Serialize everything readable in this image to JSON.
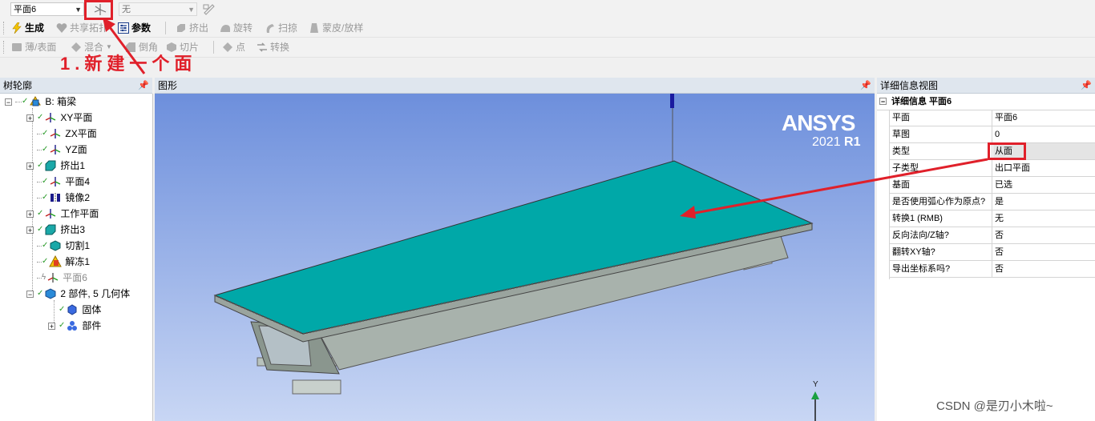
{
  "toolbar1": {
    "plane_select": "平面6",
    "sketch_select": "无"
  },
  "toolbar2": {
    "generate": "生成",
    "share_topology": "共享拓扑",
    "parameters": "参数",
    "extrude": "挤出",
    "revolve": "旋转",
    "sweep": "扫掠",
    "skin_loft": "蒙皮/放样"
  },
  "toolbar3": {
    "thin_surface": "薄/表面",
    "blend": "混合",
    "chamfer": "倒角",
    "slice": "切片",
    "point": "点",
    "conversion": "转换"
  },
  "annotation": {
    "text": "1.新建一个面",
    "color": "#e0202a"
  },
  "tree": {
    "title": "树轮廓",
    "items": [
      {
        "label": "B: 箱梁"
      },
      {
        "label": "XY平面"
      },
      {
        "label": "ZX平面"
      },
      {
        "label": "YZ面"
      },
      {
        "label": "挤出1"
      },
      {
        "label": "平面4"
      },
      {
        "label": "镜像2"
      },
      {
        "label": "工作平面"
      },
      {
        "label": "挤出3"
      },
      {
        "label": "切割1"
      },
      {
        "label": "解冻1"
      },
      {
        "label": "平面6"
      },
      {
        "label": "2 部件, 5 几何体"
      },
      {
        "label": "固体"
      },
      {
        "label": "部件"
      }
    ]
  },
  "graphics": {
    "title": "图形",
    "brand": "ANSYS",
    "version_year": "2021",
    "version_release": "R1",
    "axis_y": "Y",
    "colors": {
      "deck": "#00a8a8",
      "bg_top": "#6d8fdc",
      "bg_bottom": "#c8d6f4",
      "beam": "#b5c0b8"
    }
  },
  "details": {
    "title": "详细信息视图",
    "section": "详细信息 平面6",
    "rows": [
      {
        "key": "平面",
        "value": "平面6"
      },
      {
        "key": "草图",
        "value": "0"
      },
      {
        "key": "类型",
        "value": "从面"
      },
      {
        "key": "子类型",
        "value": "出口平面"
      },
      {
        "key": "基面",
        "value": "已选"
      },
      {
        "key": "是否使用弧心作为原点?",
        "value": "是"
      },
      {
        "key": "转换1 (RMB)",
        "value": "无"
      },
      {
        "key": "反向法向/Z轴?",
        "value": "否"
      },
      {
        "key": "翻转XY轴?",
        "value": "否"
      },
      {
        "key": "导出坐标系吗?",
        "value": "否"
      }
    ]
  },
  "watermark": "CSDN @是刃小木啦~"
}
